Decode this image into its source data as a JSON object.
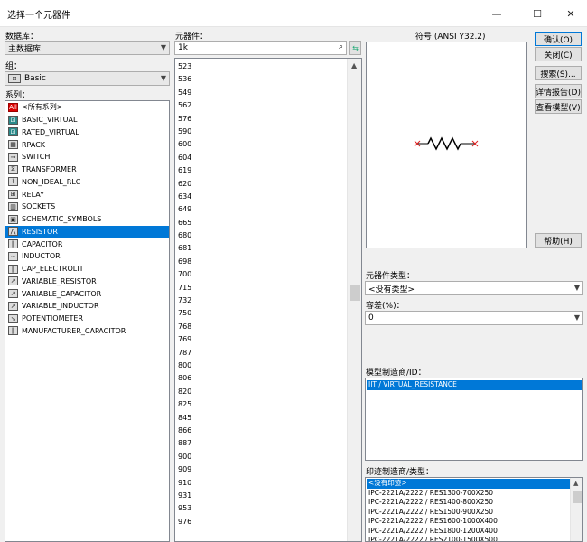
{
  "window": {
    "title": "选择一个元器件",
    "minimize": "—",
    "maximize": "☐",
    "close": "✕"
  },
  "database": {
    "label": "数据库：",
    "value": "主数据库"
  },
  "group": {
    "label": "组：",
    "value": "Basic"
  },
  "family": {
    "label": "系列：",
    "items": [
      {
        "icon": "all-icon",
        "glyph": "All",
        "label": "<所有系列>"
      },
      {
        "icon": "basic-virtual-icon",
        "glyph": "⊡",
        "label": "BASIC_VIRTUAL"
      },
      {
        "icon": "rated-virtual-icon",
        "glyph": "⊡",
        "label": "RATED_VIRTUAL"
      },
      {
        "icon": "rpack-icon",
        "glyph": "▦",
        "label": "RPACK"
      },
      {
        "icon": "switch-icon",
        "glyph": "⊸",
        "label": "SWITCH"
      },
      {
        "icon": "transformer-icon",
        "glyph": "⧖",
        "label": "TRANSFORMER"
      },
      {
        "icon": "non-ideal-rlc-icon",
        "glyph": "⌇",
        "label": "NON_IDEAL_RLC"
      },
      {
        "icon": "relay-icon",
        "glyph": "⊞",
        "label": "RELAY"
      },
      {
        "icon": "sockets-icon",
        "glyph": "▥",
        "label": "SOCKETS"
      },
      {
        "icon": "schematic-symbols-icon",
        "glyph": "▣",
        "label": "SCHEMATIC_SYMBOLS"
      },
      {
        "icon": "resistor-icon",
        "glyph": "⋀",
        "label": "RESISTOR"
      },
      {
        "icon": "capacitor-icon",
        "glyph": "‖",
        "label": "CAPACITOR"
      },
      {
        "icon": "inductor-icon",
        "glyph": "∽",
        "label": "INDUCTOR"
      },
      {
        "icon": "cap-electrolit-icon",
        "glyph": "‖",
        "label": "CAP_ELECTROLIT"
      },
      {
        "icon": "variable-resistor-icon",
        "glyph": "↗",
        "label": "VARIABLE_RESISTOR"
      },
      {
        "icon": "variable-capacitor-icon",
        "glyph": "↗",
        "label": "VARIABLE_CAPACITOR"
      },
      {
        "icon": "variable-inductor-icon",
        "glyph": "↗",
        "label": "VARIABLE_INDUCTOR"
      },
      {
        "icon": "potentiometer-icon",
        "glyph": "↘",
        "label": "POTENTIOMETER"
      },
      {
        "icon": "manufacturer-capacitor-icon",
        "glyph": "‖",
        "label": "MANUFACTURER_CAPACITOR"
      }
    ],
    "selected_index": 10
  },
  "component": {
    "label": "元器件：",
    "search_value": "1k",
    "search_btn": "⌕",
    "filter_btn": "⇆",
    "values": [
      "523",
      "536",
      "549",
      "562",
      "576",
      "590",
      "600",
      "604",
      "619",
      "620",
      "634",
      "649",
      "665",
      "680",
      "681",
      "698",
      "700",
      "715",
      "732",
      "750",
      "768",
      "769",
      "787",
      "800",
      "806",
      "820",
      "825",
      "845",
      "866",
      "887",
      "900",
      "909",
      "910",
      "931",
      "953",
      "976"
    ]
  },
  "symbol": {
    "label": "符号 (ANSI Y32.2)"
  },
  "buttons": {
    "ok": "确认(O)",
    "close": "关闭(C)",
    "search": "搜索(S)...",
    "detail": "详情报告(D)",
    "view_model": "查看模型(V)",
    "help": "帮助(H)"
  },
  "component_type": {
    "label": "元器件类型：",
    "value": "<没有类型>"
  },
  "tolerance": {
    "label": "容差(%)：",
    "value": "0"
  },
  "model_mfr": {
    "label": "模型制造商/ID：",
    "items": [
      "IIT / VIRTUAL_RESISTANCE"
    ]
  },
  "footprint": {
    "label": "印迹制造商/类型：",
    "items": [
      "<没有印迹>",
      "IPC-2221A/2222 / RES1300-700X250",
      "IPC-2221A/2222 / RES1400-800X250",
      "IPC-2221A/2222 / RES1500-900X250",
      "IPC-2221A/2222 / RES1600-1000X400",
      "IPC-2221A/2222 / RES1800-1200X400",
      "IPC-2221A/2222 / RES2100-1500X500"
    ]
  }
}
